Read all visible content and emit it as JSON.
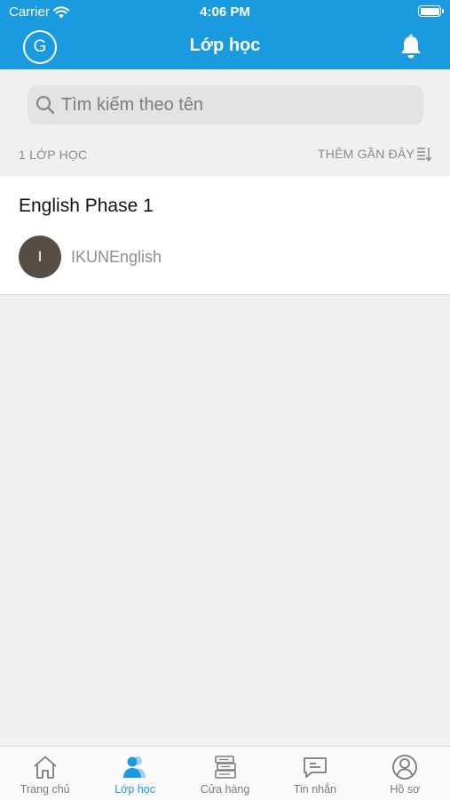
{
  "status_bar": {
    "carrier": "Carrier",
    "time": "4:06 PM"
  },
  "header": {
    "avatar_initial": "G",
    "title": "Lớp học"
  },
  "search": {
    "placeholder": "Tìm kiếm theo tên"
  },
  "list_header": {
    "count_label": "1 LỚP HỌC",
    "sort_label": "THÊM GẦN ĐÂY"
  },
  "classes": [
    {
      "name": "English Phase 1",
      "owner_initial": "I",
      "owner_name": "IKUNEnglish"
    }
  ],
  "tabs": [
    {
      "label": "Trang chủ",
      "icon": "home-icon"
    },
    {
      "label": "Lớp học",
      "icon": "class-icon",
      "active": true
    },
    {
      "label": "Cửa hàng",
      "icon": "store-icon"
    },
    {
      "label": "Tin nhắn",
      "icon": "message-icon"
    },
    {
      "label": "Hồ sơ",
      "icon": "profile-icon"
    }
  ],
  "colors": {
    "primary": "#1a9be0",
    "background": "#f0f0f0",
    "owner_avatar": "#574d45"
  }
}
